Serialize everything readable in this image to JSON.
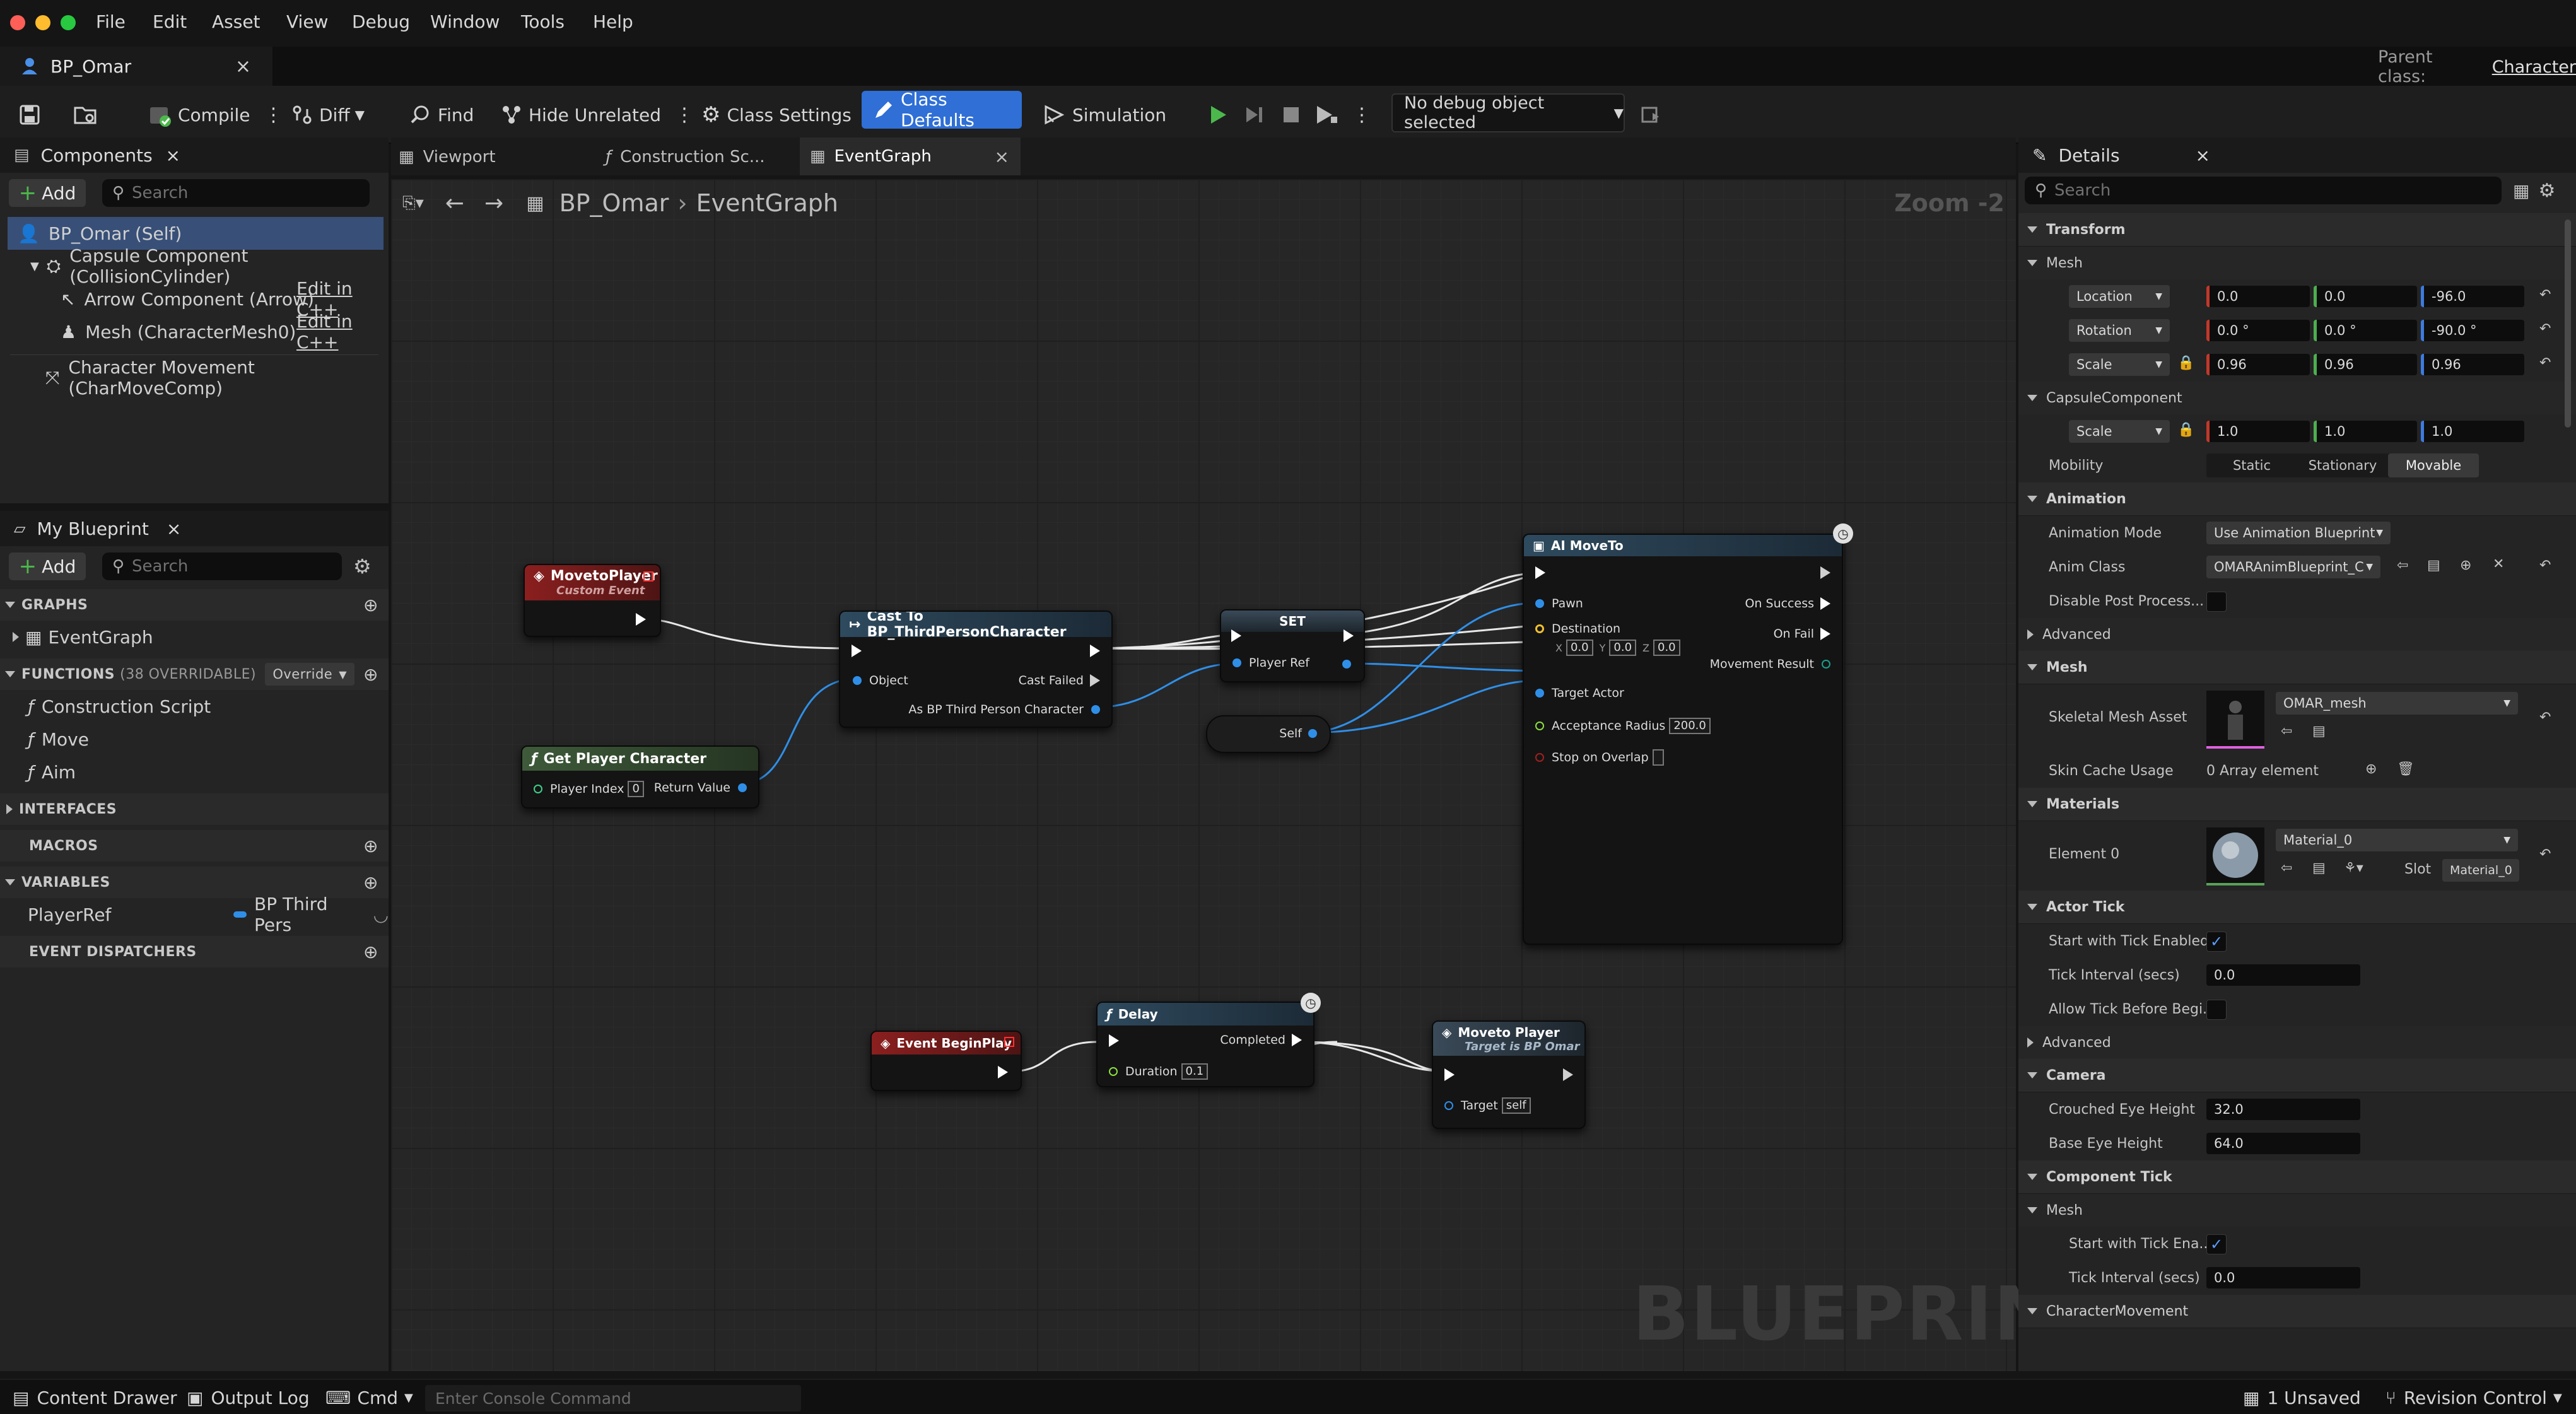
{
  "menu": [
    "File",
    "Edit",
    "Asset",
    "View",
    "Debug",
    "Window",
    "Tools",
    "Help"
  ],
  "doc_tab": {
    "title": "BP_Omar",
    "close": "×"
  },
  "parent_class": {
    "label": "Parent class:",
    "value": "Character"
  },
  "toolbar": {
    "compile": "Compile",
    "diff": "Diff",
    "find": "Find",
    "hide_unrelated": "Hide Unrelated",
    "class_settings": "Class Settings",
    "class_defaults": "Class Defaults",
    "simulation": "Simulation",
    "debug_object": "No debug object selected"
  },
  "components": {
    "title": "Components",
    "add": "Add",
    "search_placeholder": "Search",
    "root": "BP_Omar (Self)",
    "items": [
      {
        "label": "Capsule Component (CollisionCylinder)",
        "action": ""
      },
      {
        "label": "Arrow Component (Arrow)",
        "action": "Edit in C++"
      },
      {
        "label": "Mesh (CharacterMesh0)",
        "action": "Edit in C++"
      },
      {
        "label": "Character Movement (CharMoveComp)",
        "action": ""
      }
    ]
  },
  "my_blueprint": {
    "title": "My Blueprint",
    "add": "Add",
    "search_placeholder": "Search",
    "graphs": "GRAPHS",
    "event_graph": "EventGraph",
    "functions": "FUNCTIONS",
    "overridable": "(38 OVERRIDABLE)",
    "override": "Override",
    "function_items": [
      "Construction Script",
      "Move",
      "Aim"
    ],
    "interfaces": "INTERFACES",
    "macros": "MACROS",
    "variables": "VARIABLES",
    "variable": {
      "name": "PlayerRef",
      "type": "BP Third Pers"
    },
    "event_dispatchers": "EVENT DISPATCHERS"
  },
  "graph_tabs": [
    "Viewport",
    "Construction Sc...",
    "EventGraph"
  ],
  "breadcrumb": {
    "root": "BP_Omar",
    "current": "EventGraph",
    "zoom": "Zoom -2"
  },
  "watermark": "BLUEPRINT",
  "nodes": {
    "moveto_event": {
      "title": "MovetoPlayer",
      "subtitle": "Custom Event"
    },
    "cast": {
      "title": "Cast To BP_ThirdPersonCharacter",
      "object": "Object",
      "cast_failed": "Cast Failed",
      "as_bp": "As BP Third Person Character"
    },
    "set": {
      "title": "SET",
      "player_ref": "Player Ref"
    },
    "self": {
      "title": "Self"
    },
    "get_player": {
      "title": "Get Player Character",
      "player_index": "Player Index",
      "index_value": "0",
      "return_value": "Return Value"
    },
    "ai_moveto": {
      "title": "AI MoveTo",
      "pawn": "Pawn",
      "destination": "Destination",
      "x": "X",
      "xv": "0.0",
      "y": "Y",
      "yv": "0.0",
      "z": "Z",
      "zv": "0.0",
      "target_actor": "Target Actor",
      "acceptance": "Acceptance Radius",
      "acceptance_value": "200.0",
      "stop_on_overlap": "Stop on Overlap",
      "on_success": "On Success",
      "on_fail": "On Fail",
      "movement_result": "Movement Result"
    },
    "begin_play": {
      "title": "Event BeginPlay"
    },
    "delay": {
      "title": "Delay",
      "completed": "Completed",
      "duration": "Duration",
      "duration_value": "0.1"
    },
    "moveto_player": {
      "title": "Moveto Player",
      "subtitle": "Target is BP Omar",
      "target": "Target",
      "target_value": "self"
    }
  },
  "details": {
    "title": "Details",
    "search_placeholder": "Search",
    "transform": "Transform",
    "mesh_sub": "Mesh",
    "location": {
      "label": "Location",
      "x": "0.0",
      "y": "0.0",
      "z": "-96.0"
    },
    "rotation": {
      "label": "Rotation",
      "x": "0.0 °",
      "y": "0.0 °",
      "z": "-90.0 °"
    },
    "scale": {
      "label": "Scale",
      "x": "0.96",
      "y": "0.96",
      "z": "0.96"
    },
    "capsule_sub": "CapsuleComponent",
    "capsule_scale": {
      "label": "Scale",
      "x": "1.0",
      "y": "1.0",
      "z": "1.0"
    },
    "mobility": {
      "label": "Mobility",
      "options": [
        "Static",
        "Stationary",
        "Movable"
      ]
    },
    "animation": "Animation",
    "anim_mode": {
      "label": "Animation Mode",
      "value": "Use Animation Blueprint"
    },
    "anim_class": {
      "label": "Anim Class",
      "value": "OMARAnimBlueprint_C"
    },
    "disable_post": {
      "label": "Disable Post Process..."
    },
    "advanced": "Advanced",
    "mesh": "Mesh",
    "skeletal_mesh": {
      "label": "Skeletal Mesh Asset",
      "value": "OMAR_mesh"
    },
    "skin_cache": {
      "label": "Skin Cache Usage",
      "value": "0 Array element"
    },
    "materials": "Materials",
    "element0": {
      "label": "Element 0",
      "value": "Material_0",
      "slot": "Slot",
      "slot_value": "Material_0"
    },
    "actor_tick": "Actor Tick",
    "tick_enabled": {
      "label": "Start with Tick Enabled"
    },
    "tick_interval": {
      "label": "Tick Interval (secs)",
      "value": "0.0"
    },
    "allow_tick": {
      "label": "Allow Tick Before Begi..."
    },
    "advanced2": "Advanced",
    "camera": "Camera",
    "crouched": {
      "label": "Crouched Eye Height",
      "value": "32.0"
    },
    "base_eye": {
      "label": "Base Eye Height",
      "value": "64.0"
    },
    "component_tick": "Component Tick",
    "mesh_sub2": "Mesh",
    "comp_tick_enabled": {
      "label": "Start with Tick Ena..."
    },
    "comp_tick_interval": {
      "label": "Tick Interval (secs)",
      "value": "0.0"
    },
    "char_movement": "CharacterMovement"
  },
  "statusbar": {
    "content_drawer": "Content Drawer",
    "output_log": "Output Log",
    "cmd": "Cmd",
    "console_placeholder": "Enter Console Command",
    "unsaved": "1 Unsaved",
    "revision": "Revision Control"
  },
  "colors": {
    "accent": "#2f6fd6",
    "play": "#4cb84c",
    "event_head": "#8b1f1f",
    "function_head": "#2e4a5e",
    "pure_head": "#3e5a3a",
    "data_blue": "#2f8fe8"
  }
}
